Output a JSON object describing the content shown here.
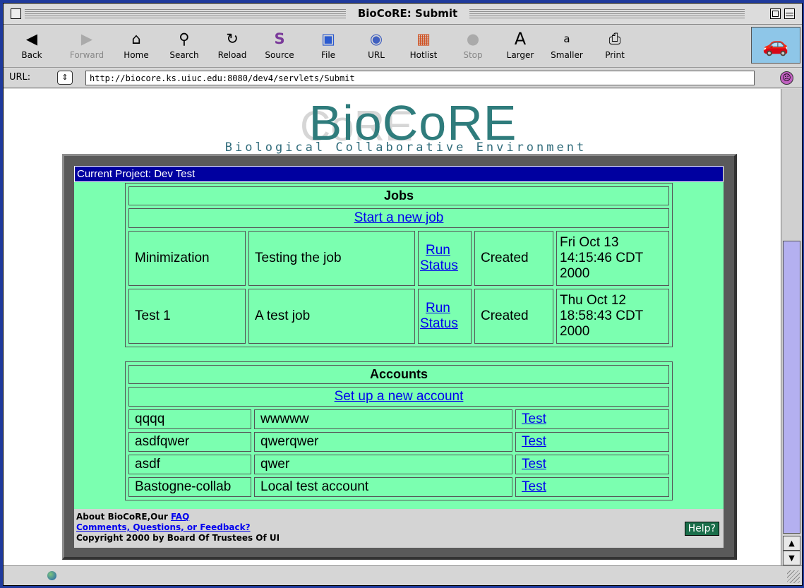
{
  "window": {
    "title": "BioCoRE: Submit"
  },
  "toolbar": {
    "back": "Back",
    "forward": "Forward",
    "home": "Home",
    "search": "Search",
    "reload": "Reload",
    "source": "Source",
    "file": "File",
    "url": "URL",
    "hotlist": "Hotlist",
    "stop": "Stop",
    "larger": "Larger",
    "smaller": "Smaller",
    "print": "Print"
  },
  "urlbar": {
    "label": "URL:",
    "value": "http://biocore.ks.uiuc.edu:8080/dev4/servlets/Submit"
  },
  "logo": {
    "title": "BioCoRE",
    "subtitle": "Biological Collaborative Environment"
  },
  "project": {
    "label": "Current Project: Dev Test"
  },
  "jobs": {
    "header": "Jobs",
    "new_link": "Start a new job",
    "rows": [
      {
        "name": "Minimization",
        "desc": "Testing the job",
        "run": "Run",
        "status_link": "Status",
        "state": "Created",
        "date": "Fri Oct 13 14:15:46 CDT 2000"
      },
      {
        "name": "Test 1",
        "desc": "A test job",
        "run": "Run",
        "status_link": "Status",
        "state": "Created",
        "date": "Thu Oct 12 18:58:43 CDT 2000"
      }
    ]
  },
  "accounts": {
    "header": "Accounts",
    "new_link": "Set up a new account",
    "rows": [
      {
        "name": "qqqq",
        "desc": "wwwww",
        "action": "Test"
      },
      {
        "name": "asdfqwer",
        "desc": "qwerqwer",
        "action": "Test"
      },
      {
        "name": "asdf",
        "desc": "qwer",
        "action": "Test"
      },
      {
        "name": "Bastogne-collab",
        "desc": "Local test account",
        "action": "Test"
      }
    ]
  },
  "footer": {
    "about": "About BioCoRE",
    "our": ",Our ",
    "faq": "FAQ",
    "comments": "Comments, Questions, or Feedback?",
    "copyright": "Copyright 2000 by Board Of Trustees Of UI",
    "help": "Help?"
  }
}
